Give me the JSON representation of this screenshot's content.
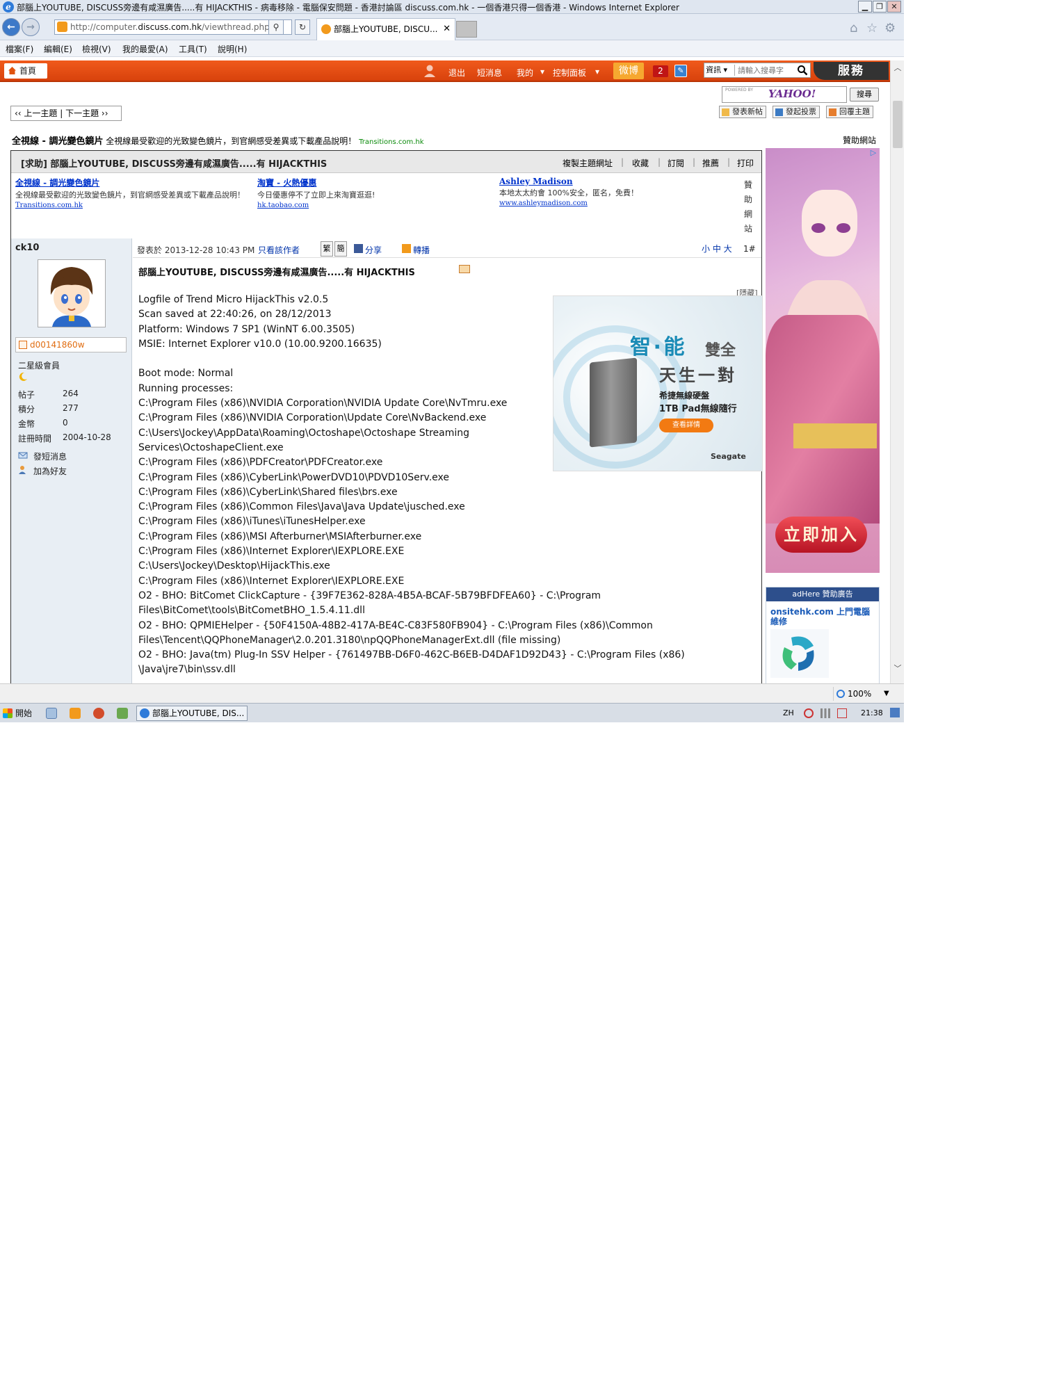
{
  "window": {
    "title": "部腦上YOUTUBE, DISCUSS旁邊有咸濕廣告.....有 HIJACKTHIS - 病毒移除 - 電腦保安問題 - 香港討論區 discuss.com.hk - 一個香港只得一個香港 - Windows Internet Explorer",
    "minimize": "▁",
    "restore": "❐",
    "close": "✕"
  },
  "browser": {
    "url_prefix": "http://computer.",
    "url_domain": "discuss.com.hk",
    "url_path": "/viewthread.php?",
    "search_glyph": "⚲",
    "refresh_glyph": "↻",
    "tab_title": "部腦上YOUTUBE, DISCU...",
    "tab_close": "✕",
    "home_glyph": "⌂",
    "fav_glyph": "☆",
    "tools_glyph": "⚙"
  },
  "menu": [
    "檔案(F)",
    "編輯(E)",
    "檢視(V)",
    "我的最愛(A)",
    "工具(T)",
    "說明(H)"
  ],
  "site_nav": {
    "home": "首頁",
    "logout": "退出",
    "messages": "短消息",
    "mine": "我的",
    "control_panel": "控制面板",
    "weibo": "微博",
    "notifications": "2",
    "search_type": "資訊",
    "search_placeholder": "請輸入搜尋字",
    "service": "服務"
  },
  "toolbar": {
    "yahoo_powered": "POWERED BY",
    "yahoo_brand": "YAHOO!",
    "search_btn": "搜尋",
    "new_topic": "發表新帖",
    "new_poll": "發起投票",
    "reply": "回覆主題",
    "prev_next": "‹‹ 上一主題 | 下一主題 ››"
  },
  "top_ad": {
    "title": "全視線 - 調光變色鏡片",
    "desc": "全視線最受歡迎的光致變色鏡片，到官網感受差異或下載產品說明！",
    "url": "Transitions.com.hk",
    "sponsor": "贊助網站"
  },
  "thread": {
    "title": "[求助] 部腦上YOUTUBE, DISCUSS旁邊有咸濕廣告.....有 HIJACKTHIS",
    "tools": [
      "複製主題網址",
      "收藏",
      "訂閱",
      "推薦",
      "打印"
    ],
    "ads": [
      {
        "title": "全視線 - 調光變色鏡片",
        "desc": "全視線最受歡迎的光致變色鏡片，到官網感受差異或下載產品說明！",
        "url": "Transitions.com.hk"
      },
      {
        "title": "淘寶 - 火熱優惠",
        "desc": "今日優惠停不了立即上來淘寶逛逛!",
        "url": "hk.taobao.com"
      },
      {
        "title": "Ashley Madison",
        "desc": "本地太太約會 100%安全，匿名，免費！",
        "url": "www.ashleymadison.com"
      }
    ],
    "sponsor_vertical": [
      "贊",
      "助",
      "網",
      "站"
    ]
  },
  "user": {
    "name": "ck10",
    "id": "d00141860w",
    "rank": "二星級會員",
    "stats": [
      {
        "label": "帖子",
        "value": "264"
      },
      {
        "label": "積分",
        "value": "277"
      },
      {
        "label": "金幣",
        "value": "0"
      },
      {
        "label": "註冊時間",
        "value": "2004-10-28"
      }
    ],
    "send_pm": "發短消息",
    "add_friend": "加為好友"
  },
  "post": {
    "date": "發表於 2013-12-28 10:43 PM",
    "author_only": "只看該作者",
    "trad": "繁",
    "simp": "簡",
    "share": "分享",
    "repost": "轉播",
    "font_size": "小 中 大",
    "floor": "1#",
    "title": "部腦上YOUTUBE, DISCUSS旁邊有咸濕廣告.....有 HIJACKTHIS",
    "hide": "[隱藏]",
    "lines": [
      "Logfile of Trend Micro HijackThis v2.0.5",
      "Scan saved at 22:40:26, on 28/12/2013",
      "Platform: Windows 7 SP1 (WinNT 6.00.3505)",
      "MSIE: Internet Explorer v10.0 (10.00.9200.16635)",
      "",
      "Boot mode: Normal",
      "Running processes:",
      "C:\\Program Files (x86)\\NVIDIA Corporation\\NVIDIA Update Core\\NvTmru.exe",
      "C:\\Program Files (x86)\\NVIDIA Corporation\\Update Core\\NvBackend.exe",
      "C:\\Users\\Jockey\\AppData\\Roaming\\Octoshape\\Octoshape Streaming",
      "Services\\OctoshapeClient.exe",
      "C:\\Program Files (x86)\\PDFCreator\\PDFCreator.exe",
      "C:\\Program Files (x86)\\CyberLink\\PowerDVD10\\PDVD10Serv.exe",
      "C:\\Program Files (x86)\\CyberLink\\Shared files\\brs.exe",
      "C:\\Program Files (x86)\\Common Files\\Java\\Java Update\\jusched.exe",
      "C:\\Program Files (x86)\\iTunes\\iTunesHelper.exe",
      "C:\\Program Files (x86)\\MSI Afterburner\\MSIAfterburner.exe",
      "C:\\Program Files (x86)\\Internet Explorer\\IEXPLORE.EXE",
      "C:\\Users\\Jockey\\Desktop\\HijackThis.exe",
      "C:\\Program Files (x86)\\Internet Explorer\\IEXPLORE.EXE",
      "O2 - BHO: BitComet ClickCapture - {39F7E362-828A-4B5A-BCAF-5B79BFDFEA60} - C:\\Program",
      "Files\\BitComet\\tools\\BitCometBHO_1.5.4.11.dll",
      "O2 - BHO: QPMIEHelper - {50F4150A-48B2-417A-BE4C-C83F580FB904} - C:\\Program Files (x86)\\Common",
      "Files\\Tencent\\QQPhoneManager\\2.0.201.3180\\npQQPhoneManagerExt.dll (file missing)",
      "O2 - BHO: Java(tm) Plug-In SSV Helper - {761497BB-D6F0-462C-B6EB-D4DAF1D92D43} - C:\\Program Files (x86)",
      "\\Java\\jre7\\bin\\ssv.dll"
    ]
  },
  "seagate_ad": {
    "headline": "智‧能",
    "headline2": "雙全",
    "subline": "天生一對",
    "line1": "希捷無線硬盤",
    "line2": "1TB Pad無線隨行",
    "cta": "查看詳情",
    "brand": "Seagate"
  },
  "side_ad": {
    "join": "立即加入",
    "adchoice": "▷"
  },
  "adhere": {
    "header": "adHere 贊助廣告",
    "link": "onsitehk.com 上門電腦維修"
  },
  "status": {
    "zoom": "100%"
  },
  "taskbar": {
    "start": "開始",
    "task_ie": "部腦上YOUTUBE, DIS...",
    "lang": "ZH",
    "clock": "21:38"
  }
}
